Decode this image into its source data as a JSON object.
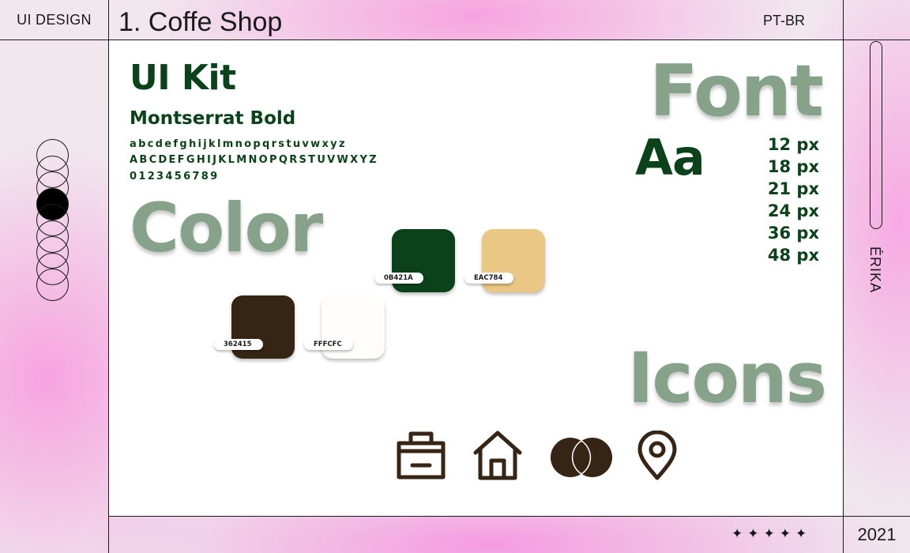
{
  "header": {
    "section_label": "UI DESIGN",
    "title": "1. Coffe Shop",
    "language": "PT-BR"
  },
  "footer": {
    "year": "2021",
    "stars": [
      "✦",
      "✦",
      "✦",
      "✦",
      "✦"
    ]
  },
  "side": {
    "author": "ÉRIKA",
    "pager": {
      "total": 9,
      "active_index": 3
    }
  },
  "kit": {
    "title": "UI Kit",
    "font_name": "Montserrat Bold",
    "lowercase": "abcdefghijklmnopqrstuvwxyz",
    "uppercase": "ABCDEFGHIJKLMNOPQRSTUVWXYZ",
    "digits": "0123456789"
  },
  "font_section": {
    "heading": "Font",
    "sample": "Aa",
    "sizes": [
      "12 px",
      "18 px",
      "21 px",
      "24 px",
      "36 px",
      "48 px"
    ]
  },
  "color_section": {
    "heading": "Color",
    "swatches": [
      {
        "hex": "#0B421A",
        "label": "0B421A"
      },
      {
        "hex": "#EAC784",
        "label": "EAC784"
      },
      {
        "hex": "#362415",
        "label": "362415"
      },
      {
        "hex": "#FFFCFC",
        "label": "FFFCFC"
      }
    ]
  },
  "icons_section": {
    "heading": "Icons",
    "icons": [
      "shopping-bag-icon",
      "home-icon",
      "card-circles-icon",
      "location-pin-icon"
    ],
    "icon_color": "#362415"
  },
  "colors": {
    "brand_green": "#0b421a",
    "muted_green": "#86a38a",
    "pink": "#f7a3e0"
  }
}
